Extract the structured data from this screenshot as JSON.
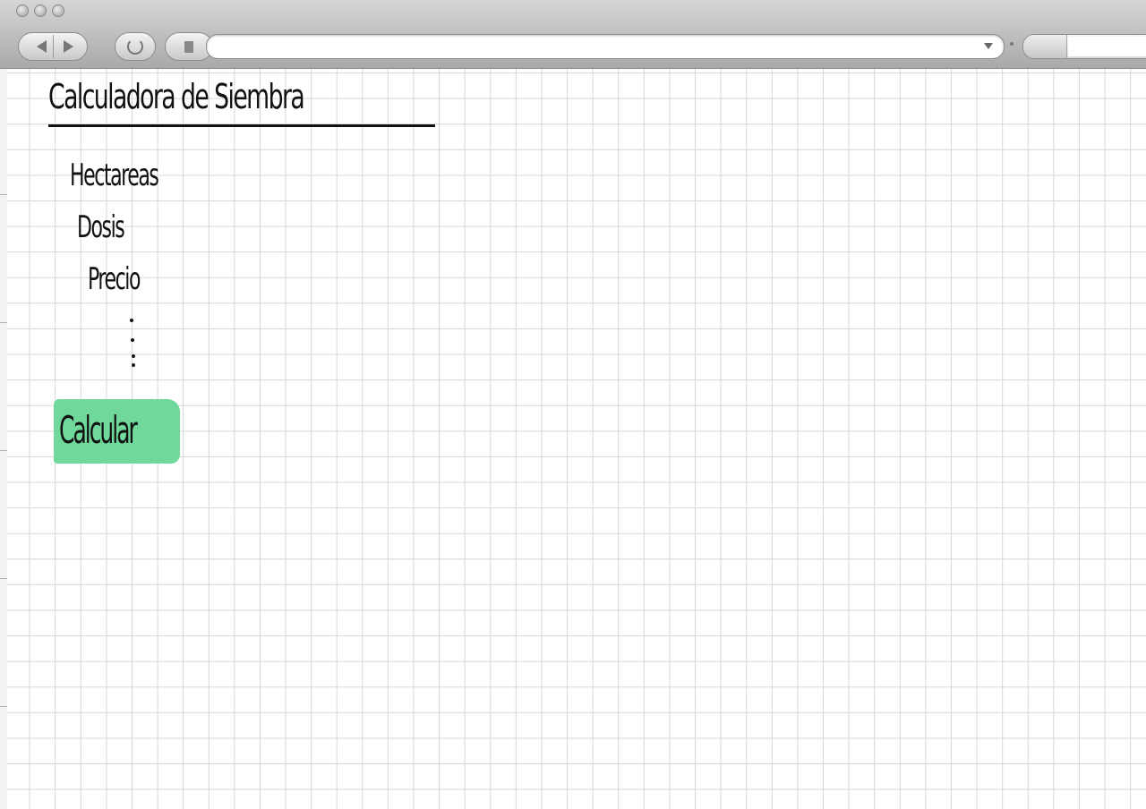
{
  "browser": {
    "url": "",
    "search": ""
  },
  "page": {
    "title": "Calculadora de Siembra",
    "fields": [
      {
        "label": "Hectareas"
      },
      {
        "label": "Dosis"
      },
      {
        "label": "Precio"
      }
    ],
    "calculate_button": "Calcular"
  },
  "colors": {
    "button_fill": "#6fd89a",
    "grid_line": "#d7d7d7",
    "ink": "#111111"
  },
  "icons": {
    "back": "back-arrow-icon",
    "forward": "forward-arrow-icon",
    "reload": "reload-icon",
    "bookmark": "page-icon",
    "dropdown": "chevron-down-icon"
  }
}
